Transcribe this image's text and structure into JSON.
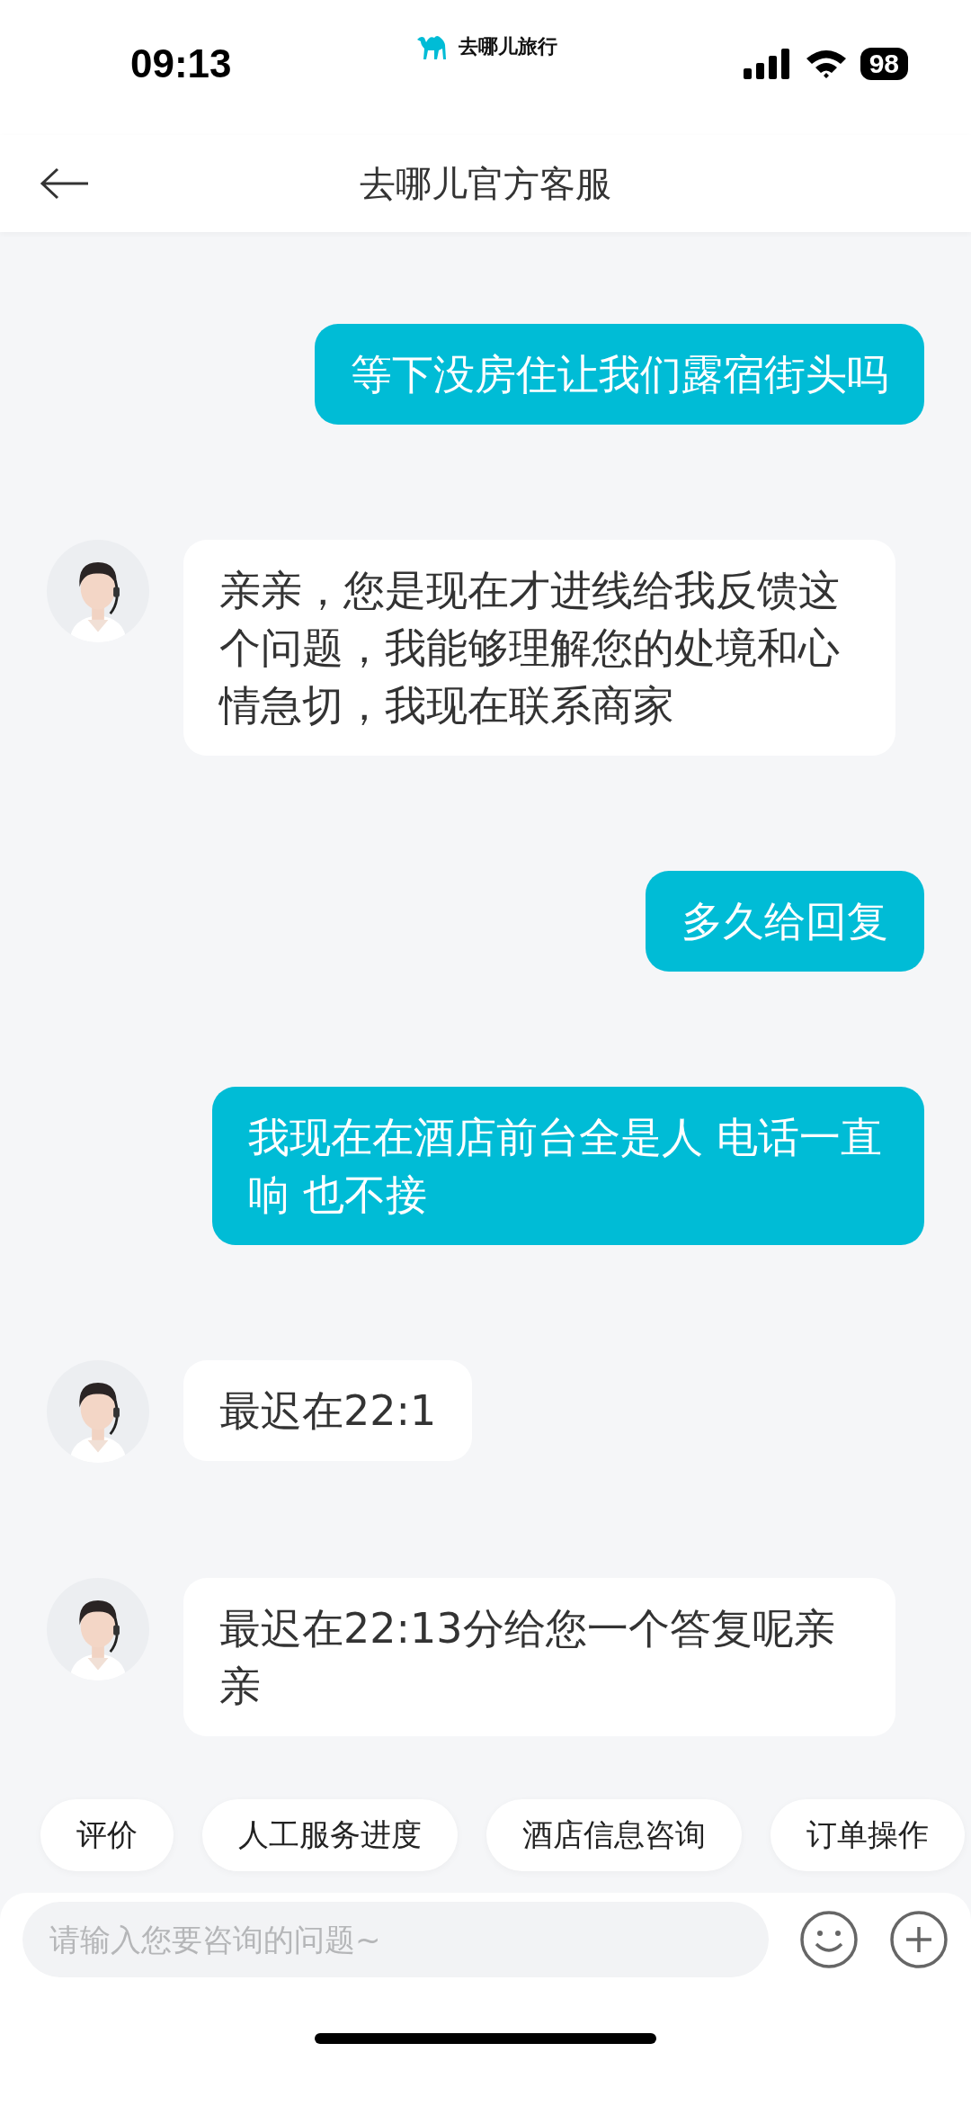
{
  "status_bar": {
    "time": "09:13",
    "app_label": "去哪儿旅行",
    "battery": "98"
  },
  "header": {
    "title": "去哪儿官方客服"
  },
  "messages": [
    {
      "kind": "outgoing",
      "text": "等下没房住让我们露宿街头吗"
    },
    {
      "kind": "incoming",
      "text": "亲亲，您是现在才进线给我反馈这个问题，我能够理解您的处境和心情急切，我现在联系商家"
    },
    {
      "kind": "outgoing",
      "text": "多久给回复"
    },
    {
      "kind": "outgoing",
      "text": "我现在在酒店前台全是人 电话一直响 也不接"
    },
    {
      "kind": "incoming",
      "text": "最迟在22:1"
    },
    {
      "kind": "incoming",
      "text": "最迟在22:13分给您一个答复呢亲亲"
    }
  ],
  "quick_replies": [
    "评价",
    "人工服务进度",
    "酒店信息咨询",
    "订单操作"
  ],
  "input": {
    "placeholder": "请输入您要咨询的问题~"
  }
}
